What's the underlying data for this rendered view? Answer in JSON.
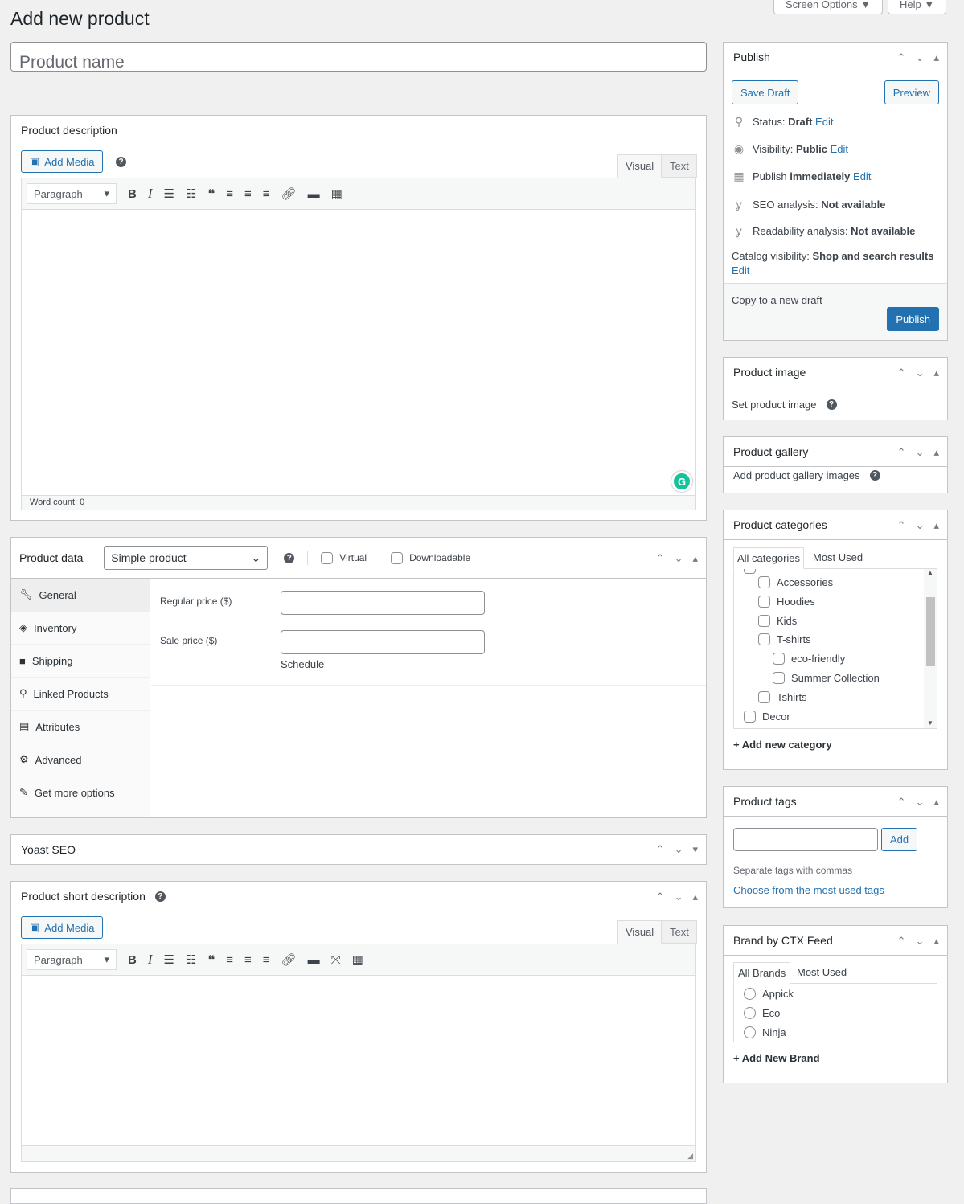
{
  "header": {
    "title": "Add new product",
    "screen_options": "Screen Options ▼",
    "help": "Help ▼",
    "product_name_placeholder": "Product name"
  },
  "description": {
    "title": "Product description",
    "add_media": "Add Media",
    "tab_visual": "Visual",
    "tab_text": "Text",
    "format": "Paragraph",
    "word_count": "Word count: 0"
  },
  "product_data": {
    "title": "Product data —",
    "type": "Simple product",
    "virtual": "Virtual",
    "downloadable": "Downloadable",
    "tabs": [
      {
        "label": "General",
        "icon": "wrench"
      },
      {
        "label": "Inventory",
        "icon": "tag"
      },
      {
        "label": "Shipping",
        "icon": "truck"
      },
      {
        "label": "Linked Products",
        "icon": "link"
      },
      {
        "label": "Attributes",
        "icon": "list"
      },
      {
        "label": "Advanced",
        "icon": "gear"
      },
      {
        "label": "Get more options",
        "icon": "plugin"
      }
    ],
    "regular_price": "Regular price ($)",
    "sale_price": "Sale price ($)",
    "schedule": "Schedule"
  },
  "yoast": {
    "title": "Yoast SEO"
  },
  "short_description": {
    "title": "Product short description",
    "add_media": "Add Media",
    "tab_visual": "Visual",
    "tab_text": "Text",
    "format": "Paragraph"
  },
  "publish": {
    "title": "Publish",
    "save_draft": "Save Draft",
    "preview": "Preview",
    "status_label": "Status: ",
    "status_value": "Draft",
    "visibility_label": "Visibility: ",
    "visibility_value": "Public",
    "publish_label": "Publish ",
    "publish_value": "immediately",
    "edit": "Edit",
    "seo_label": "SEO analysis: ",
    "seo_value": "Not available",
    "read_label": "Readability analysis: ",
    "read_value": "Not available",
    "catalog_label": "Catalog visibility: ",
    "catalog_value": "Shop and search results",
    "copy": "Copy to a new draft",
    "publish_button": "Publish"
  },
  "product_image": {
    "title": "Product image",
    "link": "Set product image"
  },
  "product_gallery": {
    "title": "Product gallery",
    "link": "Add product gallery images"
  },
  "categories": {
    "title": "Product categories",
    "tab_all": "All categories",
    "tab_most": "Most Used",
    "items": [
      {
        "label": "Accessories",
        "level": 1
      },
      {
        "label": "Hoodies",
        "level": 1
      },
      {
        "label": "Kids",
        "level": 1
      },
      {
        "label": "T-shirts",
        "level": 1
      },
      {
        "label": "eco-friendly",
        "level": 2
      },
      {
        "label": "Summer Collection",
        "level": 2
      },
      {
        "label": "Tshirts",
        "level": 1
      },
      {
        "label": "Decor",
        "level": 0
      }
    ],
    "add_new": "+ Add new category"
  },
  "tags": {
    "title": "Product tags",
    "add": "Add",
    "hint": "Separate tags with commas",
    "choose": "Choose from the most used tags"
  },
  "brand": {
    "title": "Brand by CTX Feed",
    "tab_all": "All Brands",
    "tab_most": "Most Used",
    "items": [
      "Appick",
      "Eco",
      "Ninja"
    ],
    "add_new": "+ Add New Brand"
  },
  "colors": {
    "accent": "#2271b1",
    "background": "#f0f0f1"
  }
}
